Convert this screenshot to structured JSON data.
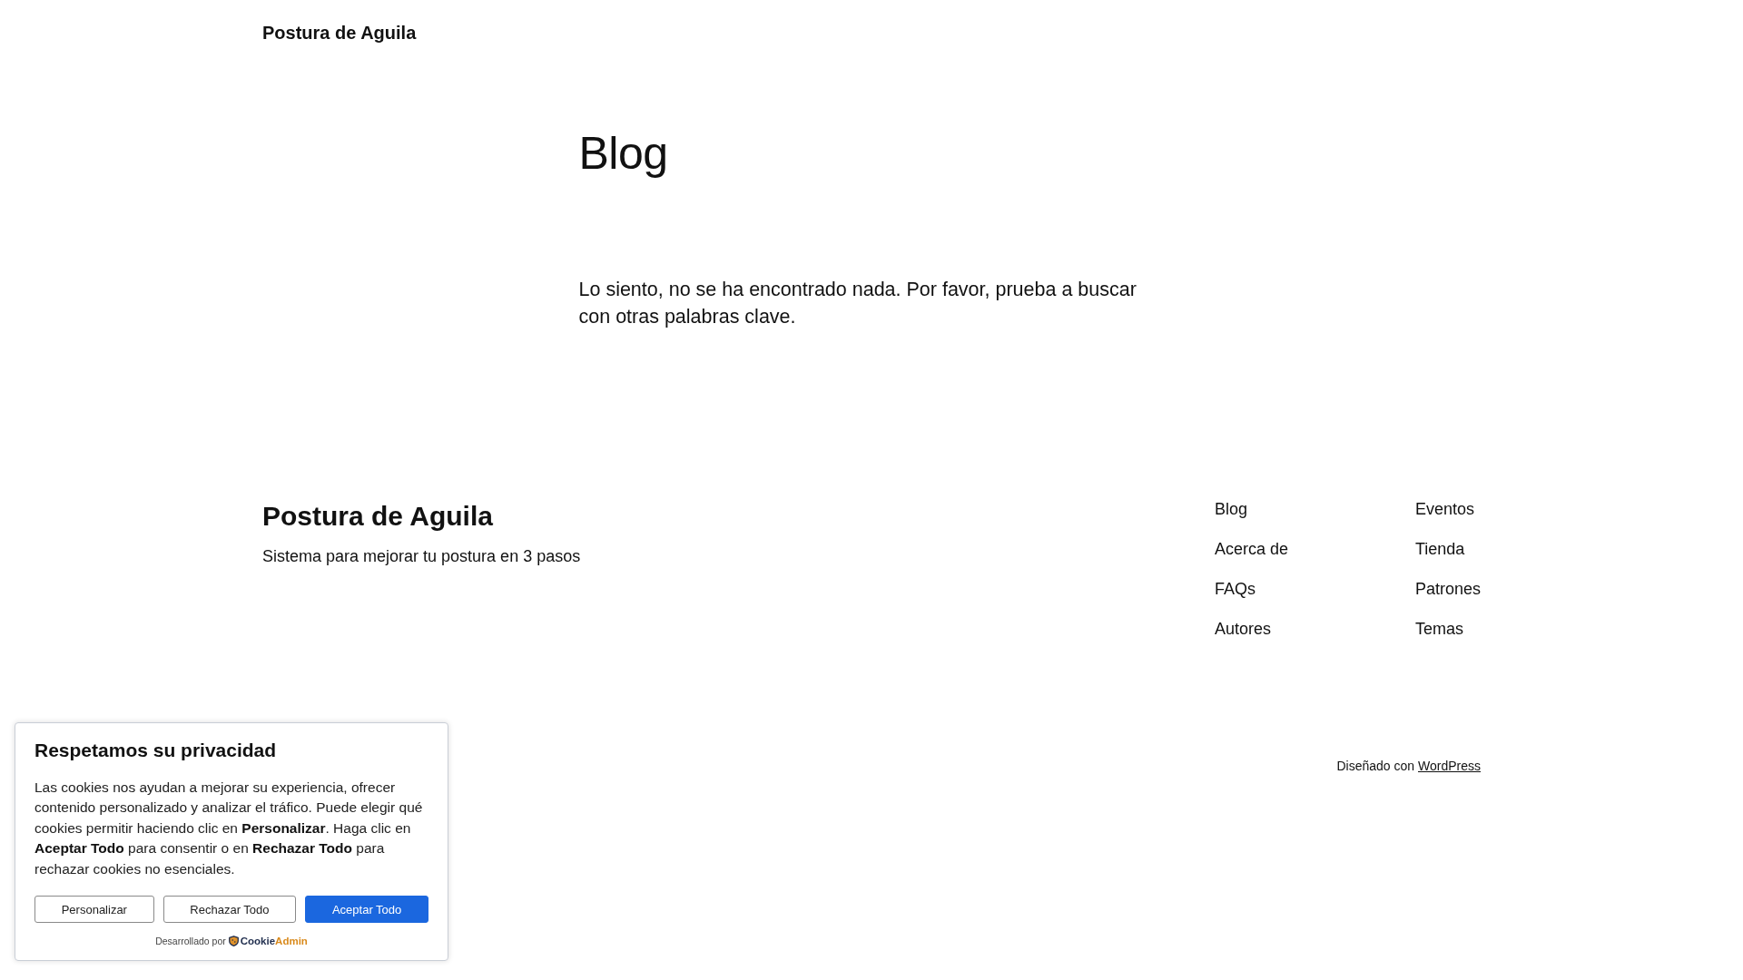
{
  "header": {
    "site_title": "Postura de Aguila"
  },
  "main": {
    "title": "Blog",
    "message": "Lo siento, no se ha encontrado nada. Por favor, prueba a buscar con otras palabras clave."
  },
  "footer": {
    "site_title": "Postura de Aguila",
    "tagline": "Sistema para mejorar tu postura en 3 pasos",
    "nav_columns": [
      [
        "Blog",
        "Acerca de",
        "FAQs",
        "Autores"
      ],
      [
        "Eventos",
        "Tienda",
        "Patrones",
        "Temas"
      ]
    ],
    "credit": {
      "text": "Diseñado con",
      "link": "WordPress"
    }
  },
  "cookie_banner": {
    "title": "Respetamos su privacidad",
    "message": "Las cookies nos ayudan a mejorar su experiencia, ofrecer contenido personalizado y analizar el tráfico. Puede elegir qué cookies permitir haciendo clic en **Personalizar**. Haga clic en **Aceptar Todo** para consentir o en **Rechazar Todo** para rechazar cookies no esenciales.",
    "buttons": [
      {
        "label": "Personalizar",
        "kind": "secondary"
      },
      {
        "label": "Rechazar Todo",
        "kind": "secondary"
      },
      {
        "label": "Aceptar Todo",
        "kind": "primary"
      }
    ],
    "powered_by": {
      "text": "Desarrollado por",
      "brand": [
        "Cookie",
        "Admin"
      ]
    }
  }
}
